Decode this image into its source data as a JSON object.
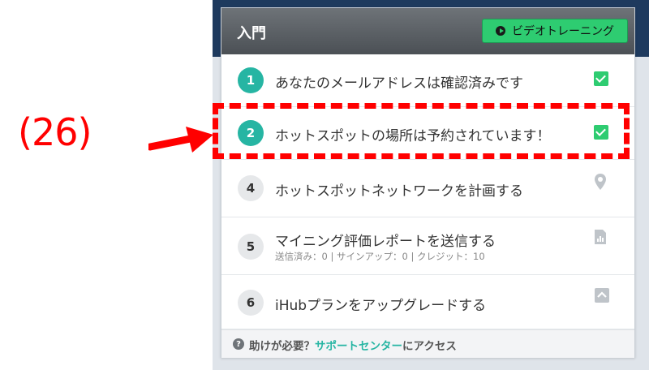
{
  "header": {
    "title": "入門",
    "video_button_label": "ビデオトレーニング"
  },
  "steps": [
    {
      "number": "1",
      "label": "あなたのメールアドレスは確認済みです",
      "status": "completed",
      "icon": "check-icon"
    },
    {
      "number": "2",
      "label": "ホットスポットの場所は予約されています！",
      "status": "completed",
      "icon": "check-icon"
    },
    {
      "number": "4",
      "label": "ホットスポットネットワークを計画する",
      "status": "pending",
      "icon": "map-pin-icon"
    },
    {
      "number": "5",
      "label": "マイニング評価レポートを送信する",
      "sub": "送信済み：0 | サインアップ：0 | クレジット：10",
      "status": "pending",
      "icon": "report-icon"
    },
    {
      "number": "6",
      "label": "iHubプランをアップグレードする",
      "status": "pending",
      "icon": "upgrade-icon"
    }
  ],
  "footer": {
    "help_prefix": "助けが必要？",
    "help_link": "サポートセンター",
    "help_suffix": "にアクセス"
  },
  "annotation": {
    "label": "(26)"
  },
  "colors": {
    "accent": "#26b5a3",
    "button_green": "#2ecc71",
    "annotation_red": "#ff0000"
  }
}
